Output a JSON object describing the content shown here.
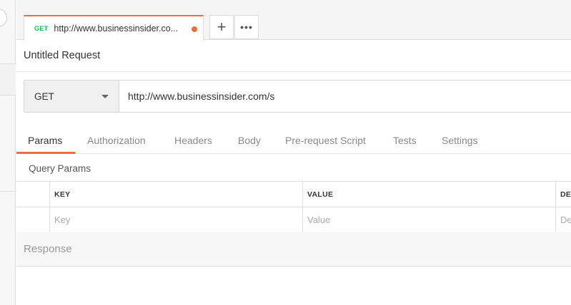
{
  "tab": {
    "method": "GET",
    "url": "http://www.businessinsider.co...",
    "unsaved_color": "#f26b3a"
  },
  "tab_actions": {
    "add_icon": "plus-icon",
    "add_glyph": "+",
    "more_icon": "more-icon",
    "more_glyph": "•••"
  },
  "request": {
    "title": "Untitled Request",
    "method": "GET",
    "url": "http://www.businessinsider.com/s"
  },
  "subtabs": [
    "Params",
    "Authorization",
    "Headers",
    "Body",
    "Pre-request Script",
    "Tests",
    "Settings"
  ],
  "active_subtab": "Params",
  "query_params": {
    "label": "Query Params",
    "headers": [
      "KEY",
      "VALUE",
      "DE"
    ],
    "placeholders": [
      "Key",
      "Value",
      "De"
    ]
  },
  "response": {
    "label": "Response"
  },
  "colors": {
    "accent": "#f26b3a",
    "get_method": "#0cbb52"
  }
}
